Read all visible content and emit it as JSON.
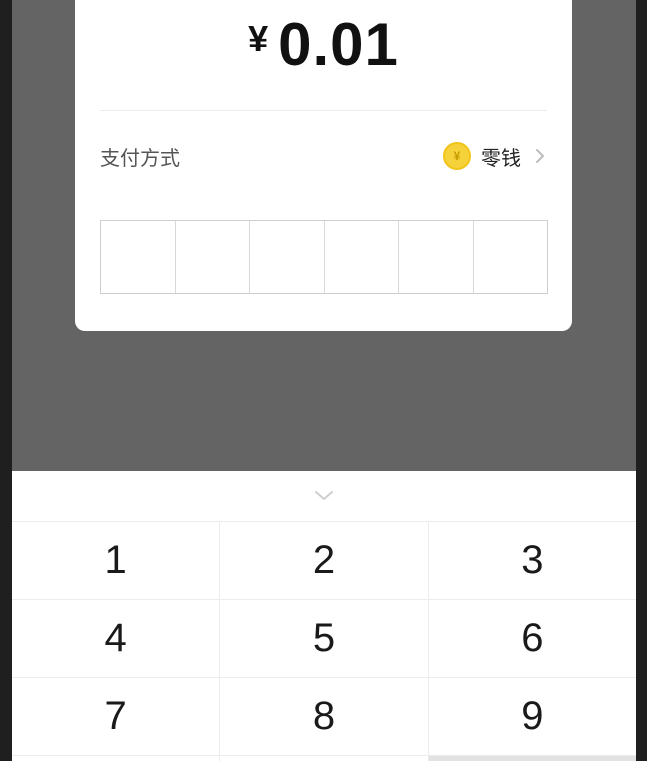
{
  "payment": {
    "currency_symbol": "¥",
    "amount": "0.01",
    "method_label": "支付方式",
    "method_name": "零钱",
    "coin_icon": "coin-icon",
    "pin_length": 6
  },
  "keypad": {
    "handle_icon": "chevron-down-icon",
    "rows": [
      [
        "1",
        "2",
        "3"
      ],
      [
        "4",
        "5",
        "6"
      ],
      [
        "7",
        "8",
        "9"
      ]
    ]
  },
  "colors": {
    "overlay": "#646464",
    "coin": "#f5d13a",
    "card": "#ffffff"
  }
}
